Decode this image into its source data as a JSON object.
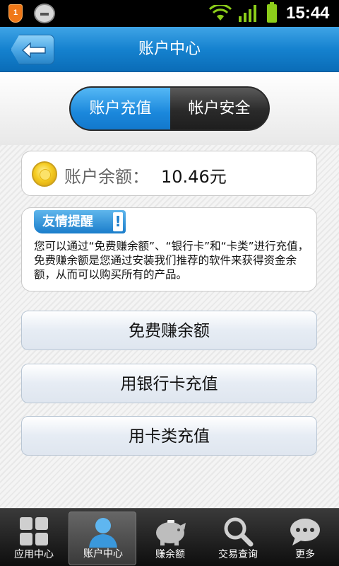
{
  "status_bar": {
    "notification_count": "1",
    "time": "15:44",
    "icons": [
      "notification-badge-icon",
      "usb-icon",
      "wifi-icon",
      "signal-icon",
      "battery-icon"
    ]
  },
  "header": {
    "title": "账户中心",
    "back_icon": "back-arrow-icon"
  },
  "tabs": [
    {
      "label": "账户充值",
      "active": true
    },
    {
      "label": "帐户安全",
      "active": false
    }
  ],
  "balance": {
    "label": "账户余额：",
    "value": "10.46元",
    "icon": "coin-icon"
  },
  "notice": {
    "title": "友情提醒",
    "mark": "!",
    "text": "您可以通过“免费赚余额”、“银行卡”和“卡类”进行充值，免费赚余额是您通过安装我们推荐的软件来获得资金余额，从而可以购买所有的产品。"
  },
  "actions": [
    {
      "label": "免费赚余额"
    },
    {
      "label": "用银行卡充值"
    },
    {
      "label": "用卡类充值"
    }
  ],
  "bottom_nav": [
    {
      "label": "应用中心",
      "icon": "grid-icon",
      "active": false
    },
    {
      "label": "账户中心",
      "icon": "user-icon",
      "active": true
    },
    {
      "label": "赚余额",
      "icon": "piggy-bank-icon",
      "active": false
    },
    {
      "label": "交易查询",
      "icon": "search-icon",
      "active": false
    },
    {
      "label": "更多",
      "icon": "more-chat-icon",
      "active": false
    }
  ],
  "colors": {
    "header_blue": "#1582cf",
    "active_tab": "#1b88dc",
    "inactive_tab": "#2e2e2e",
    "notice_badge": "#1a7dcb",
    "coin": "#f5cc22"
  }
}
